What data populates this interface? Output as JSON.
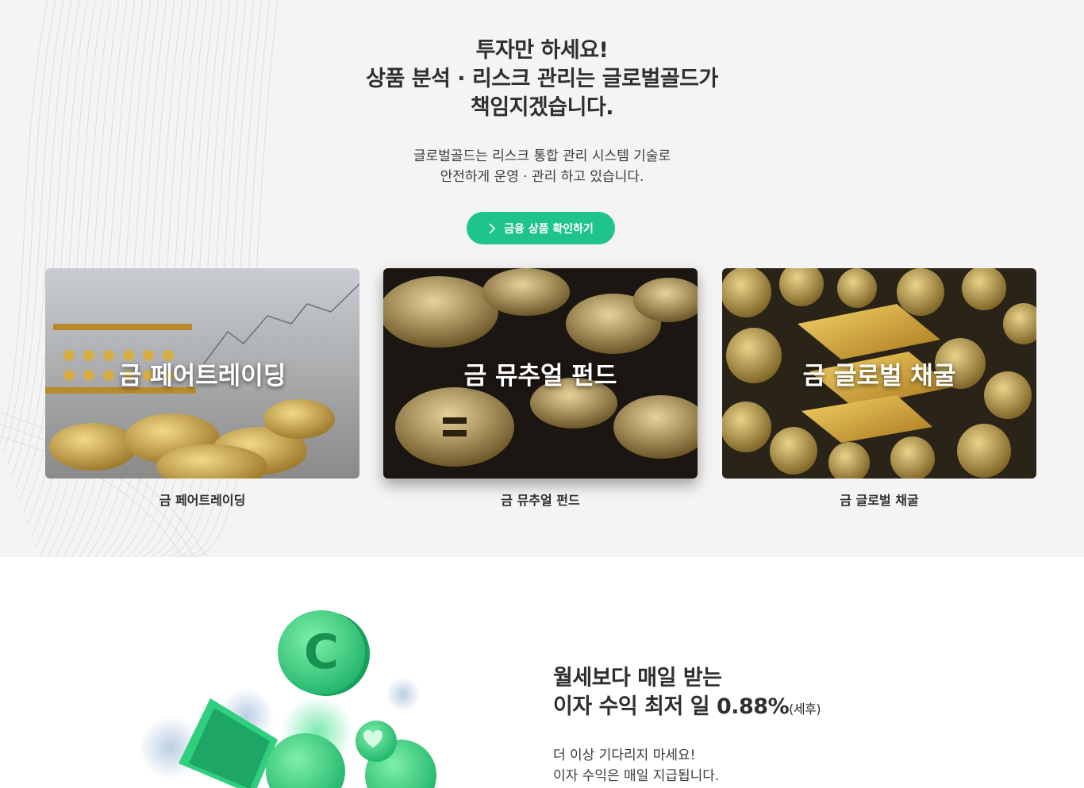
{
  "hero": {
    "headline": [
      "투자만 하세요!",
      "상품 분석 · 리스크 관리는 글로벌골드가",
      "책임지겠습니다."
    ],
    "subtext": [
      "글로벌골드는 리스크 통합 관리 시스템 기술로",
      "안전하게 운영 · 관리 하고 있습니다."
    ],
    "cta_label": "금융 상품 확인하기",
    "cta_icon": "chevron-right-icon",
    "accent_color": "#1fc48a"
  },
  "products": [
    {
      "overlay_title": "금 페어트레이딩",
      "label": "금 페어트레이딩"
    },
    {
      "overlay_title": "금 뮤추얼 펀드",
      "label": "금 뮤추얼 펀드"
    },
    {
      "overlay_title": "금 글로벌 채굴",
      "label": "금 글로벌 채굴"
    }
  ],
  "interest": {
    "title_line1": "월세보다 매일 받는",
    "title_line2": "이자 수익 최저 일 0.88%",
    "title_suffix": "(세후)",
    "text": [
      "더 이상 기다리지 마세요!",
      "이자 수익은 매일 지급됩니다."
    ]
  }
}
